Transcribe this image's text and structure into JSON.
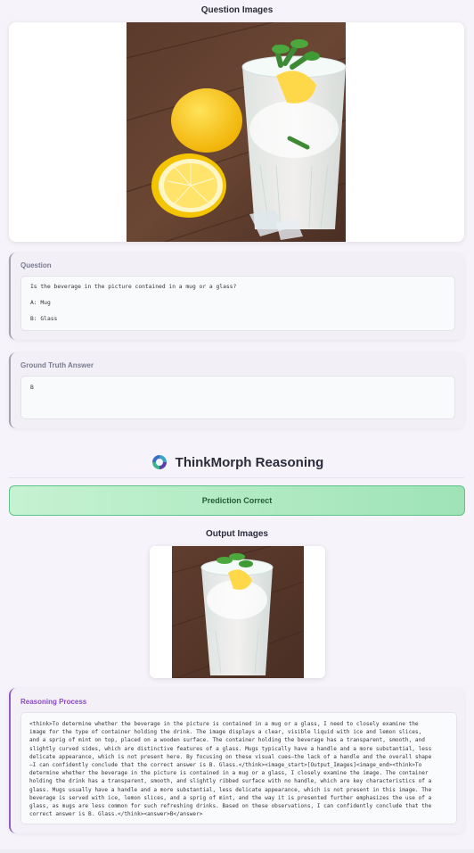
{
  "question_images": {
    "title": "Question Images"
  },
  "question": {
    "label": "Question",
    "text": "Is the beverage in the picture contained in a mug or a glass?",
    "options": [
      "A: Mug",
      "B: Glass"
    ]
  },
  "ground_truth": {
    "label": "Ground Truth Answer",
    "value": "B"
  },
  "brand": {
    "name": "ThinkMorph Reasoning",
    "icon": "thinkmorph-logo-icon"
  },
  "prediction": {
    "status": "Prediction Correct",
    "color": "#5cc488"
  },
  "output_images": {
    "title": "Output Images"
  },
  "reasoning": {
    "label": "Reasoning Process",
    "lines": [
      "<think>To determine whether the beverage in the picture is contained in a mug or a glass, I need to closely examine the",
      "image for the type of container holding the drink. The image displays a clear, visible liquid with ice and lemon slices,",
      "and a sprig of mint on top, placed on a wooden surface. The container holding the beverage has a transparent, smooth, and",
      "slightly curved sides, which are distinctive features of a glass. Mugs typically have a handle and a more substantial, less",
      "delicate appearance, which is not present here. By focusing on these visual cues—the lack of a handle and the overall shape",
      "—I can confidently conclude that the correct answer is B. Glass.</think><image_start>[Output_Images]<image_end><think>To",
      "determine whether the beverage in the picture is contained in a mug or a glass, I closely examine the image. The container",
      "holding the drink has a transparent, smooth, and slightly ribbed surface with no handle, which are key characteristics of a",
      "glass. Mugs usually have a handle and a more substantial, less delicate appearance, which is not present in this image. The",
      "beverage is served with ice, lemon slices, and a sprig of mint, and the way it is presented further emphasizes the use of a",
      "glass, as mugs are less common for such refreshing drinks. Based on these observations, I can confidently conclude that the",
      "correct answer is B. Glass.</think><answer>B</answer>"
    ]
  }
}
